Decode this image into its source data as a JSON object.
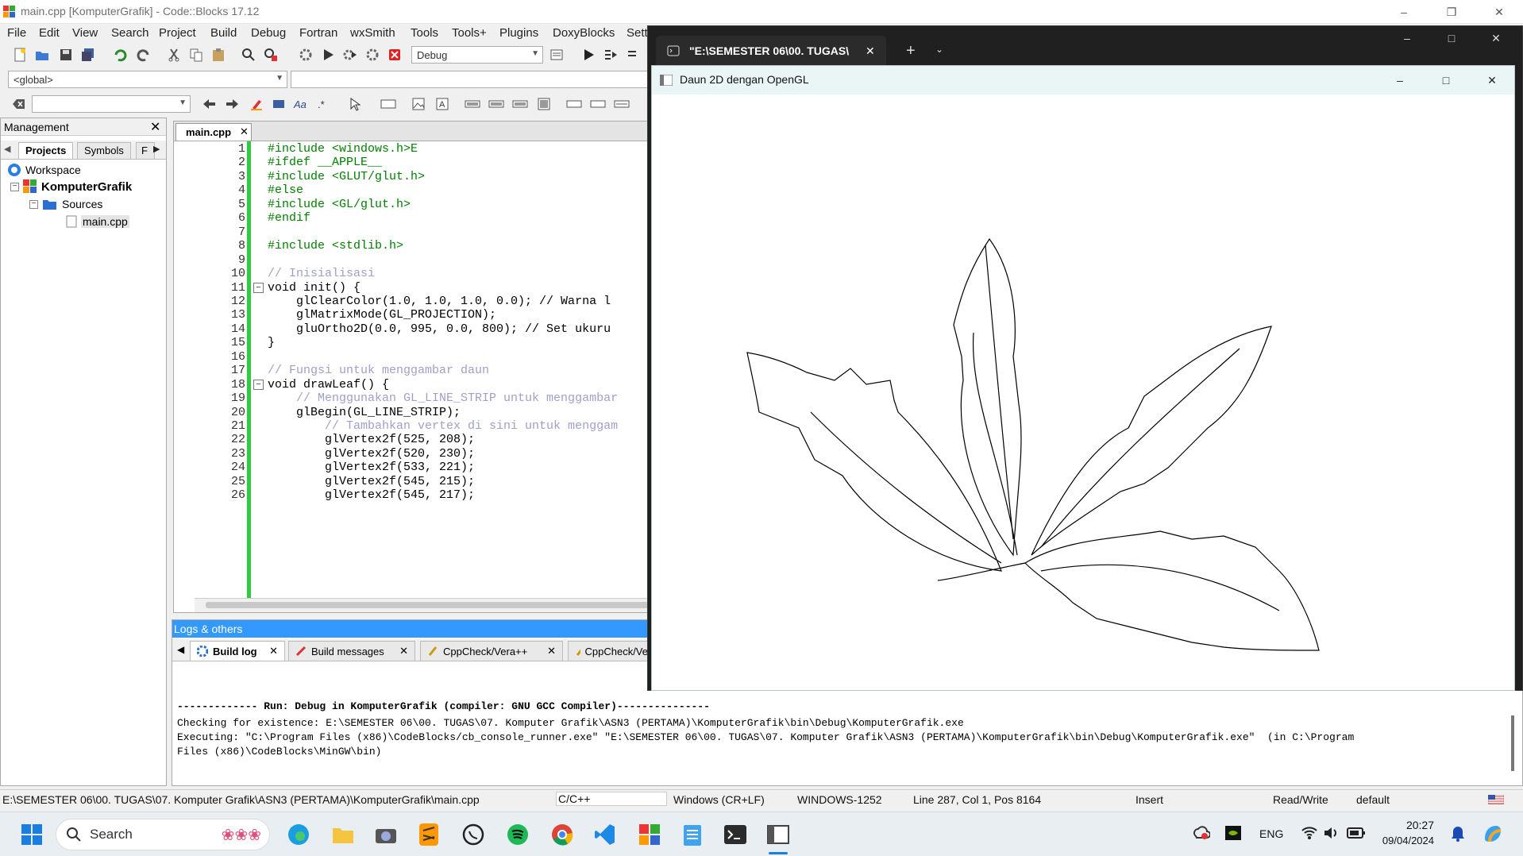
{
  "codeblocks": {
    "title": "main.cpp [KomputerGrafik] - Code::Blocks 17.12",
    "menu": [
      "File",
      "Edit",
      "View",
      "Search",
      "Project",
      "Build",
      "Debug",
      "Fortran",
      "wxSmith",
      "Tools",
      "Tools+",
      "Plugins",
      "DoxyBlocks",
      "Setti"
    ],
    "build_target": "Debug",
    "scope": "<global>",
    "management": {
      "title": "Management",
      "tabs": [
        "Projects",
        "Symbols",
        "F"
      ],
      "tree": {
        "workspace": "Workspace",
        "project": "KomputerGrafik",
        "folder": "Sources",
        "file": "main.cpp"
      }
    },
    "editor": {
      "tab": "main.cpp",
      "line_numbers": [
        "1",
        "2",
        "3",
        "4",
        "5",
        "6",
        "7",
        "8",
        "9",
        "10",
        "11",
        "12",
        "13",
        "14",
        "15",
        "16",
        "17",
        "18",
        "19",
        "20",
        "21",
        "22",
        "23",
        "24",
        "25",
        "26"
      ],
      "lines": [
        "#include <windows.h>E",
        "#ifdef __APPLE__",
        "#include <GLUT/glut.h>",
        "#else",
        "#include <GL/glut.h>",
        "#endif",
        "",
        "#include <stdlib.h>",
        "",
        "// Inisialisasi",
        "void init() {",
        "    glClearColor(1.0, 1.0, 1.0, 0.0); // Warna l",
        "    glMatrixMode(GL_PROJECTION);",
        "    gluOrtho2D(0.0, 995, 0.0, 800); // Set ukuru",
        "}",
        "",
        "// Fungsi untuk menggambar daun",
        "void drawLeaf() {",
        "    // Menggunakan GL_LINE_STRIP untuk menggambar",
        "    glBegin(GL_LINE_STRIP);",
        "        // Tambahkan vertex di sini untuk menggam",
        "        glVertex2f(525, 208);",
        "        glVertex2f(520, 230);",
        "        glVertex2f(533, 221);",
        "        glVertex2f(545, 215);",
        "        glVertex2f(545, 217);"
      ]
    },
    "logs": {
      "title": "Logs & others",
      "tabs": [
        "Build log",
        "Build messages",
        "CppCheck/Vera++",
        "CppCheck/Ve"
      ],
      "lines": [
        "------------- Run: Debug in KomputerGrafik (compiler: GNU GCC Compiler)---------------",
        "Checking for existence: E:\\SEMESTER 06\\00. TUGAS\\07. Komputer Grafik\\ASN3 (PERTAMA)\\KomputerGrafik\\bin\\Debug\\KomputerGrafik.exe",
        "Executing: \"C:\\Program Files (x86)\\CodeBlocks/cb_console_runner.exe\" \"E:\\SEMESTER 06\\00. TUGAS\\07. Komputer Grafik\\ASN3 (PERTAMA)\\KomputerGrafik\\bin\\Debug\\KomputerGrafik.exe\"  (in C:\\Program",
        "Files (x86)\\CodeBlocks\\MinGW\\bin)"
      ]
    },
    "status": {
      "path": "E:\\SEMESTER 06\\00. TUGAS\\07. Komputer Grafik\\ASN3 (PERTAMA)\\KomputerGrafik\\main.cpp",
      "language": "C/C++",
      "eol": "Windows (CR+LF)",
      "encoding": "WINDOWS-1252",
      "position": "Line 287, Col 1, Pos 8164",
      "mode": "Insert",
      "access": "Read/Write",
      "profile": "default"
    }
  },
  "terminal": {
    "tab_title": "\"E:\\SEMESTER 06\\00. TUGAS\\"
  },
  "gl_window": {
    "title": "Daun 2D dengan OpenGL"
  },
  "taskbar": {
    "search_placeholder": "Search",
    "lang": "ENG",
    "time": "20:27",
    "date": "09/04/2024"
  },
  "colors": {
    "accent": "#3399ff",
    "green_bar": "#2ecc40",
    "keyword": "#00008b",
    "preprocessor": "#008000",
    "number": "#d000d0",
    "comment": "#a0a0c8"
  }
}
